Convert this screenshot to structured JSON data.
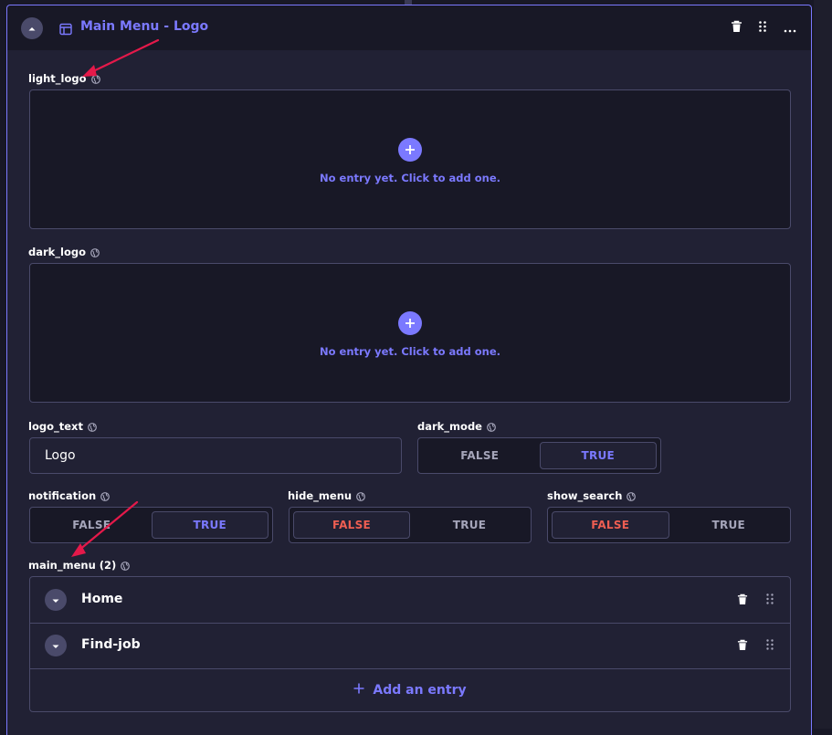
{
  "colors": {
    "accent": "#7b79ff",
    "danger": "#ee5e52",
    "background": "#181826",
    "panel": "#212134",
    "border": "#4a4a6a",
    "muted_text": "#a5a5ba",
    "annotation_arrow": "#e5194a"
  },
  "component": {
    "title": "Main Menu - Logo",
    "icon": "layout-icon",
    "actions": [
      "trash-icon",
      "drag-icon",
      "more-icon"
    ]
  },
  "fields": {
    "light_logo": {
      "label": "light_logo",
      "empty_text": "No entry yet. Click to add one."
    },
    "dark_logo": {
      "label": "dark_logo",
      "empty_text": "No entry yet. Click to add one."
    },
    "logo_text": {
      "label": "logo_text",
      "value": "Logo"
    },
    "dark_mode": {
      "label": "dark_mode",
      "false_label": "FALSE",
      "true_label": "TRUE",
      "selected": "TRUE"
    },
    "notification": {
      "label": "notification",
      "false_label": "FALSE",
      "true_label": "TRUE",
      "selected": "TRUE"
    },
    "hide_menu": {
      "label": "hide_menu",
      "false_label": "FALSE",
      "true_label": "TRUE",
      "selected": "FALSE"
    },
    "show_search": {
      "label": "show_search",
      "false_label": "FALSE",
      "true_label": "TRUE",
      "selected": "FALSE"
    },
    "main_menu": {
      "label": "main_menu (2)",
      "items": [
        {
          "label": "Home"
        },
        {
          "label": "Find-job"
        }
      ],
      "add_label": "Add an entry"
    }
  }
}
